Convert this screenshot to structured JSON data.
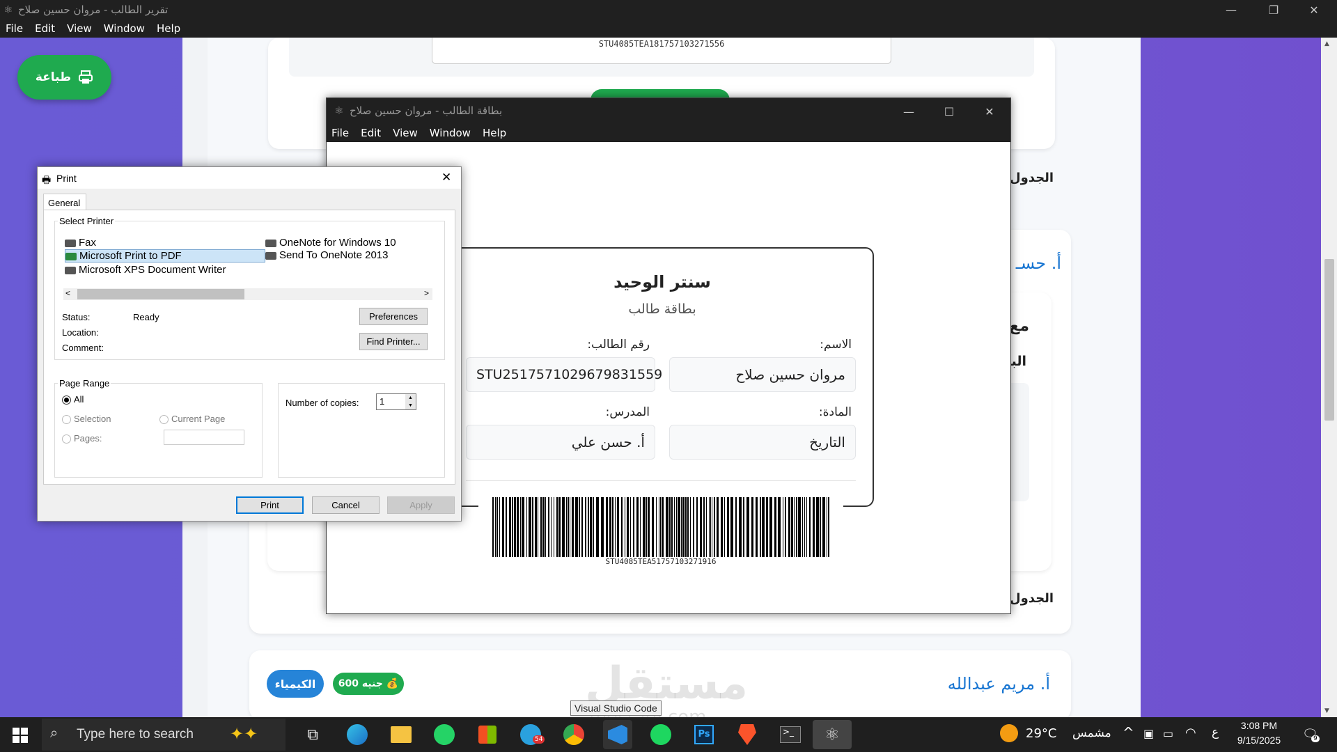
{
  "main_window": {
    "title": "تقرير الطالب - مروان حسين صلاح",
    "menu": [
      "File",
      "Edit",
      "View",
      "Window",
      "Help"
    ]
  },
  "print_button": {
    "label": "طباعة"
  },
  "report": {
    "top_barcode_text": "STU4085TEA181757103271556",
    "schedule_label_1": "الجدول",
    "teacher_1_partial": "أ. حسـ",
    "subject_partial": "مع",
    "date_partial": "البار",
    "schedule_label_2": "الجدول",
    "teacher_2": "أ. مريم عبدالله",
    "subject_badge": "الكيمياء",
    "price_badge": "600 جنيه",
    "watermark": "مستقل",
    "watermark_sub": "mostaql.com"
  },
  "card_window": {
    "title": "بطاقة الطالب - مروان حسين صلاح",
    "menu": [
      "File",
      "Edit",
      "View",
      "Window",
      "Help"
    ],
    "center_name": "سنتر الوحيد",
    "card_title": "بطاقة طالب",
    "name_label": "الاسم:",
    "name_value": "مروان حسين صلاح",
    "id_label": "رقم الطالب:",
    "id_value": "STU2517571029679831559",
    "subject_label": "المادة:",
    "subject_value": "التاريخ",
    "teacher_label": "المدرس:",
    "teacher_value": "أ. حسن علي",
    "barcode_text": "STU4085TEA51757103271916"
  },
  "print_dialog": {
    "title": "Print",
    "tab": "General",
    "select_printer_label": "Select Printer",
    "printers": [
      "Fax",
      "Microsoft Print to PDF",
      "Microsoft XPS Document Writer",
      "OneNote for Windows 10",
      "Send To OneNote 2013"
    ],
    "selected_printer": "Microsoft Print to PDF",
    "status_label": "Status:",
    "status_value": "Ready",
    "location_label": "Location:",
    "comment_label": "Comment:",
    "preferences_btn": "Preferences",
    "find_printer_btn": "Find Printer...",
    "page_range_label": "Page Range",
    "range_all": "All",
    "range_selection": "Selection",
    "range_current": "Current Page",
    "range_pages": "Pages:",
    "copies_label": "Number of copies:",
    "copies_value": "1",
    "print_btn": "Print",
    "cancel_btn": "Cancel",
    "apply_btn": "Apply"
  },
  "taskbar": {
    "search_placeholder": "Type here to search",
    "tooltip": "Visual Studio Code",
    "weather_temp": "29°C",
    "weather_text": "مشمس",
    "lang": "ع",
    "time": "3:08 PM",
    "date": "9/15/2025",
    "telegram_badge": "54",
    "notif_count": "9"
  }
}
